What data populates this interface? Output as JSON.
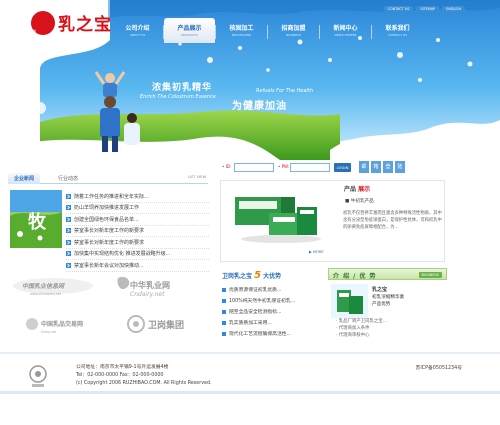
{
  "header": {
    "logo_text": "乳之宝",
    "top_links": [
      "CONTACT US",
      "SITEMAP",
      "ENGLISH"
    ],
    "nav": [
      {
        "cn": "公司介绍",
        "en": "ABOUT US"
      },
      {
        "cn": "产品展示",
        "en": "PRODUCTS"
      },
      {
        "cn": "核固加工",
        "en": "PROCESSING"
      },
      {
        "cn": "招商加盟",
        "en": "BUSINESS"
      },
      {
        "cn": "新闻中心",
        "en": "NEWS CENTER"
      },
      {
        "cn": "联系我们",
        "en": "CONTACT US"
      }
    ]
  },
  "banner": {
    "slogan_left": "浓集初乳精华",
    "slogan_left_en": "Enrich The Colostrum Essence",
    "slogan_right_en": "Refuels For The Health",
    "slogan_right": "为健康加油"
  },
  "news": {
    "tab_active": "企业新闻",
    "tab_other": "行业动态",
    "more": "LIST VIEW",
    "image_text": "牧",
    "items": [
      "随着工作任务的推进和全年实际...",
      "奶山羊饲养加快推进发展工作",
      "创建全国绿色环保食品名单...",
      "禁室事长对新年度工作的新要求",
      "禁室事长对新年度工作的新要求",
      "加快集中实现结构优化 推进发展战略升级...",
      "禁室事长新年会议对加快推动..."
    ]
  },
  "partners": {
    "p1": "中国乳业信息网",
    "p1_sub": "www.chinadairy.net",
    "p2": "中华乳业网",
    "p2_sub": "Cndairy.net",
    "p3": "中国乳品交易网",
    "p3_sub": "Dairy.net",
    "p4": "卫岗集团"
  },
  "login": {
    "id_label": "• ID:",
    "pw_label": "• PW:",
    "button": "LOGIN",
    "reg_links": [
      "邮",
      "箱",
      "登",
      "陆"
    ]
  },
  "product": {
    "title_a": "产品",
    "title_b": "展示",
    "name": "■ 牛初乳产品",
    "desc": "初乳不仅营养丰富而且富含多种特殊活性物质，其中含有分泌型免疫球蛋白，是保护性抗体，可和初乳中的卵黄免疫屏障相配合，为...",
    "more": "▶ MORE"
  },
  "advantages": {
    "title_a": "卫岗乳之宝",
    "title_num": "5",
    "title_b": "大优势",
    "items": [
      "优质原源保证初乳优质...",
      "100%纯天然牛初乳保证初乳...",
      "随至全品安全检测指标...",
      "乳实质质加工采用...",
      "现代化工艺流程确保高活性..."
    ]
  },
  "rbox": {
    "title": "介 绍 / 优 势",
    "badge": "BUSINESS",
    "line1": "乳之宝",
    "line2": "初乳浓缩精华素",
    "line3": "产品优势",
    "list": [
      "· 乳品厂转产卫岗乳之宝...",
      "· 代理商加入条件",
      "· 代理商审核中心"
    ]
  },
  "footer": {
    "address": "公司地址：南京市太平镇9-1号外运发展4楼",
    "tel": "Tel：02-000-0000   Fax：02-000-0000",
    "copyright": "(c) Copyright 2006 RUZHIBAO.COM. All Rights Reserved.",
    "icp": "苏ICP备05051234号"
  },
  "colors": {
    "brand_red": "#d8121b",
    "brand_blue": "#2a6fb8",
    "sky": "#36a3ec",
    "grass": "#62b42a"
  }
}
